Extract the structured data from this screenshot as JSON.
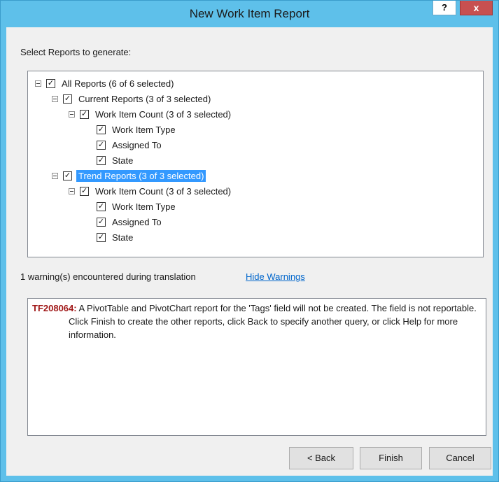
{
  "window": {
    "title": "New Work Item Report",
    "help_label": "?",
    "close_label": "x"
  },
  "prompt": "Select Reports to generate:",
  "tree": {
    "rows": [
      {
        "label": "All Reports (6 of 6 selected)",
        "checked": true,
        "expanded": true
      },
      {
        "label": "Current Reports (3 of 3 selected)",
        "checked": true,
        "expanded": true
      },
      {
        "label": "Work Item Count (3 of 3 selected)",
        "checked": true,
        "expanded": true
      },
      {
        "label": "Work Item Type",
        "checked": true
      },
      {
        "label": "Assigned To",
        "checked": true
      },
      {
        "label": "State",
        "checked": true
      },
      {
        "label": "Trend Reports (3 of 3 selected)",
        "checked": true,
        "expanded": true,
        "selected": true
      },
      {
        "label": "Work Item Count (3 of 3 selected)",
        "checked": true,
        "expanded": true
      },
      {
        "label": "Work Item Type",
        "checked": true
      },
      {
        "label": "Assigned To",
        "checked": true
      },
      {
        "label": "State",
        "checked": true
      }
    ],
    "check_glyph": "✓"
  },
  "warnings": {
    "status_text": "1 warning(s) encountered during translation",
    "toggle_link": "Hide Warnings",
    "code": "TF208064:",
    "message": " A PivotTable and PivotChart report for the 'Tags' field will not be created. The field is not reportable. Click Finish to create the other reports, click Back to specify another query, or click Help for more information."
  },
  "buttons": {
    "back": "< Back",
    "finish": "Finish",
    "cancel": "Cancel"
  },
  "colors": {
    "titlebar": "#5ec0ea",
    "selection": "#3399ff",
    "error_code": "#a01818",
    "link": "#0066cc"
  }
}
